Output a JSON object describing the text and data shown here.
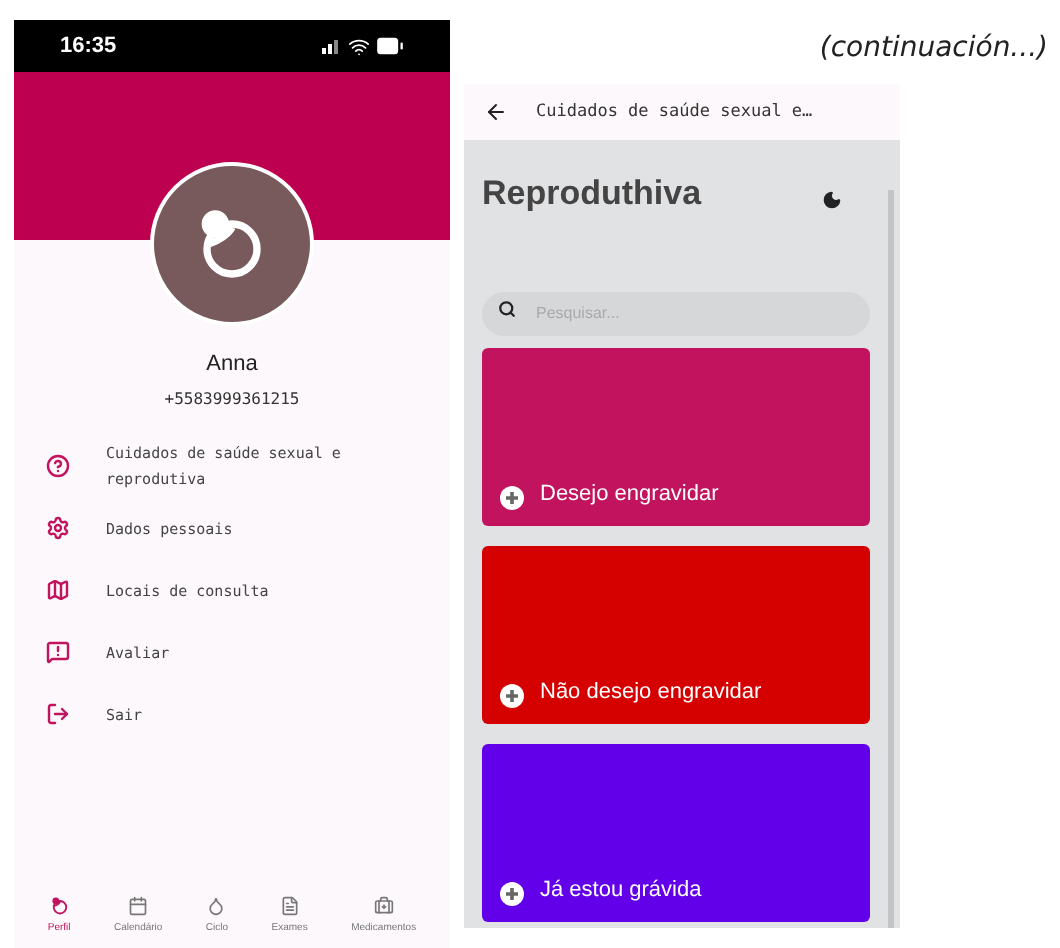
{
  "caption": "(continuación...)",
  "profile_screen": {
    "status_bar": {
      "time": "16:35"
    },
    "user": {
      "name": "Anna",
      "phone": "+5583999361215"
    },
    "menu": [
      {
        "kind": "help",
        "label": "Cuidados de saúde sexual e reprodutiva"
      },
      {
        "kind": "settings",
        "label": "Dados pessoais"
      },
      {
        "kind": "map",
        "label": "Locais de consulta"
      },
      {
        "kind": "feedback",
        "label": "Avaliar"
      },
      {
        "kind": "logout",
        "label": "Sair"
      }
    ],
    "bottom_nav": [
      {
        "kind": "profile",
        "label": "Perfil",
        "selected": true
      },
      {
        "kind": "calendar",
        "label": "Calendário",
        "selected": false
      },
      {
        "kind": "cycle",
        "label": "Ciclo",
        "selected": false
      },
      {
        "kind": "exams",
        "label": "Exames",
        "selected": false
      },
      {
        "kind": "medicines",
        "label": "Medicamentos",
        "selected": false
      }
    ]
  },
  "care_screen": {
    "app_bar_title": "Cuidados de saúde sexual e…",
    "title": "Reproduthiva",
    "search": {
      "placeholder": "Pesquisar..."
    },
    "cards": [
      {
        "label": "Desejo engravidar",
        "color": "#c2135e"
      },
      {
        "label": "Não desejo engravidar",
        "color": "#d50000"
      },
      {
        "label": "Já estou grávida",
        "color": "#6200ea"
      }
    ]
  }
}
